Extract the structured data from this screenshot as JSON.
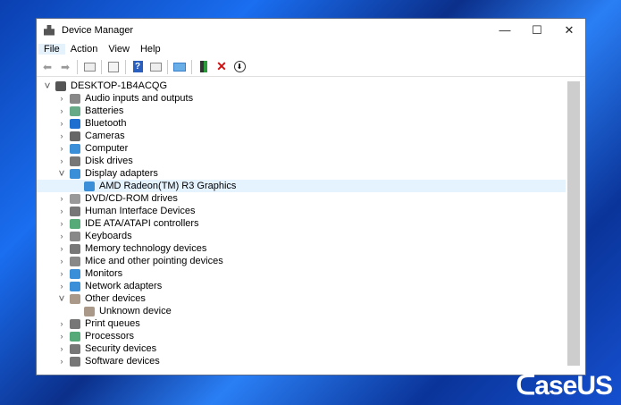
{
  "window": {
    "title": "Device Manager",
    "minimize": "—",
    "maximize": "☐",
    "close": "✕"
  },
  "menu": [
    "File",
    "Action",
    "View",
    "Help"
  ],
  "toolbar": [
    "back-icon",
    "forward-icon",
    "properties-icon",
    "view-icon",
    "help-icon",
    "show-hidden-icon",
    "scan-icon",
    "add-driver-icon",
    "uninstall-icon",
    "update-icon"
  ],
  "tree": {
    "root": "DESKTOP-1B4ACQG",
    "items": [
      {
        "label": "Audio inputs and outputs",
        "color": "#888"
      },
      {
        "label": "Batteries",
        "color": "#6a8"
      },
      {
        "label": "Bluetooth",
        "color": "#1f6fd0"
      },
      {
        "label": "Cameras",
        "color": "#666"
      },
      {
        "label": "Computer",
        "color": "#3a8fd8"
      },
      {
        "label": "Disk drives",
        "color": "#777"
      },
      {
        "label": "Display adapters",
        "color": "#3a8fd8",
        "expanded": true,
        "children": [
          "AMD Radeon(TM) R3 Graphics"
        ]
      },
      {
        "label": "DVD/CD-ROM drives",
        "color": "#999"
      },
      {
        "label": "Human Interface Devices",
        "color": "#777"
      },
      {
        "label": "IDE ATA/ATAPI controllers",
        "color": "#5a7"
      },
      {
        "label": "Keyboards",
        "color": "#888"
      },
      {
        "label": "Memory technology devices",
        "color": "#777"
      },
      {
        "label": "Mice and other pointing devices",
        "color": "#888"
      },
      {
        "label": "Monitors",
        "color": "#3a8fd8"
      },
      {
        "label": "Network adapters",
        "color": "#3a8fd8"
      },
      {
        "label": "Other devices",
        "color": "#a98",
        "expanded": true,
        "children": [
          "Unknown device"
        ]
      },
      {
        "label": "Print queues",
        "color": "#777"
      },
      {
        "label": "Processors",
        "color": "#5a7"
      },
      {
        "label": "Security devices",
        "color": "#777"
      },
      {
        "label": "Software devices",
        "color": "#777"
      }
    ]
  },
  "watermark": "EaseUS"
}
